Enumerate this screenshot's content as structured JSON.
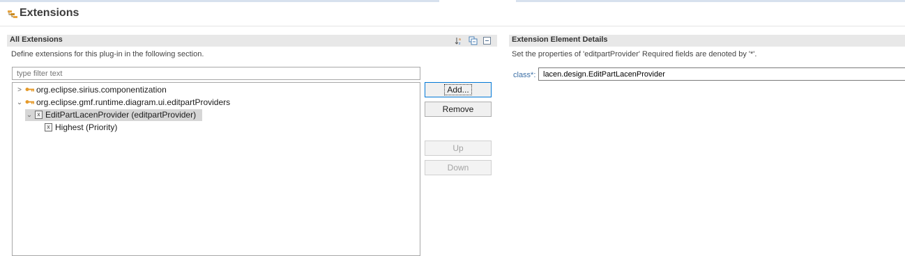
{
  "page": {
    "title": "Extensions"
  },
  "all_extensions": {
    "title": "All Extensions",
    "description": "Define extensions for this plug-in in the following section.",
    "filter_placeholder": "type filter text",
    "toolbar": [
      "sort-icon",
      "collapse-all-icon",
      "minimize-icon"
    ],
    "tree": [
      {
        "label": "org.eclipse.sirius.componentization",
        "expanded": false,
        "level": 0,
        "icon": "plug-in-icon"
      },
      {
        "label": "org.eclipse.gmf.runtime.diagram.ui.editpartProviders",
        "expanded": true,
        "level": 0,
        "icon": "plug-in-icon"
      },
      {
        "label": "EditPartLacenProvider (editpartProvider)",
        "expanded": true,
        "level": 1,
        "icon": "element-icon",
        "selected": true
      },
      {
        "label": "Highest (Priority)",
        "level": 2,
        "icon": "element-icon"
      }
    ],
    "buttons": {
      "add": "Add...",
      "remove": "Remove",
      "up": "Up",
      "down": "Down"
    }
  },
  "details": {
    "title": "Extension Element Details",
    "description": "Set the properties of 'editpartProvider' Required fields are denoted by '*'.",
    "class_label": "class*:",
    "class_value": "lacen.design.EditPartLacenProvider"
  },
  "colors": {
    "accent": "#0078d7",
    "link_label": "#3a6ea5",
    "selection": "#d6d6d6",
    "section_bar": "#e8e8e8"
  }
}
